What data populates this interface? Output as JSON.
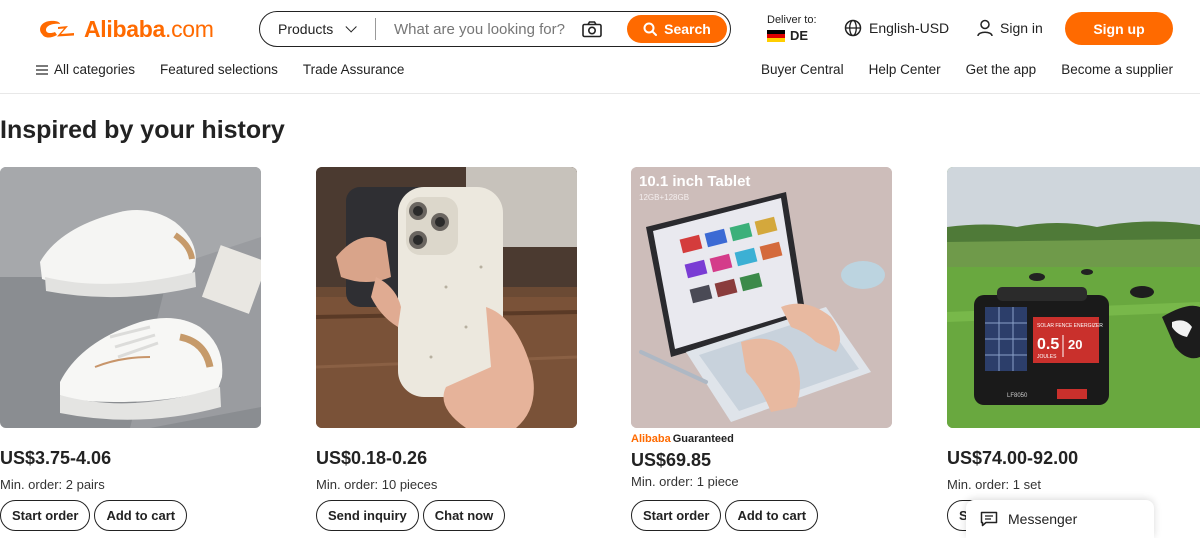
{
  "brand": {
    "name": "Alibaba",
    "suffix": ".com",
    "accent_color": "#ff6a00"
  },
  "search": {
    "category_label": "Products",
    "placeholder": "What are you looking for?",
    "button_label": "Search"
  },
  "deliver": {
    "label": "Deliver to:",
    "country": "DE"
  },
  "language": {
    "label": "English-USD"
  },
  "account": {
    "sign_in": "Sign in",
    "sign_up": "Sign up"
  },
  "subnav": {
    "left": [
      "All categories",
      "Featured selections",
      "Trade Assurance"
    ],
    "right": [
      "Buyer Central",
      "Help Center",
      "Get the app",
      "Become a supplier"
    ]
  },
  "section": {
    "title": "Inspired by your history"
  },
  "products": [
    {
      "image": "white-sneakers",
      "price": "US$3.75-4.06",
      "moq": "Min. order: 2 pairs",
      "buttons": [
        "Start order",
        "Add to cart"
      ]
    },
    {
      "image": "phone-case",
      "price": "US$0.18-0.26",
      "moq": "Min. order: 10 pieces",
      "buttons": [
        "Send inquiry",
        "Chat now"
      ]
    },
    {
      "image": "tablet-keyboard",
      "image_caption": "10.1 inch Tablet",
      "image_subcaption": "12GB+128GB",
      "badge_brand": "Alibaba",
      "badge_text": "Guaranteed",
      "price": "US$69.85",
      "moq": "Min. order: 1 piece",
      "buttons": [
        "Start order",
        "Add to cart"
      ]
    },
    {
      "image": "solar-fence-energizer",
      "image_label_top": "SOLAR FENCE ENERGIZER",
      "image_joules": "0.5",
      "image_joules_unit": "JOULES",
      "image_km": "20",
      "image_model": "LF8050",
      "price": "US$74.00-92.00",
      "moq": "Min. order: 1 set",
      "buttons": [
        "S"
      ]
    }
  ],
  "messenger": {
    "label": "Messenger"
  }
}
